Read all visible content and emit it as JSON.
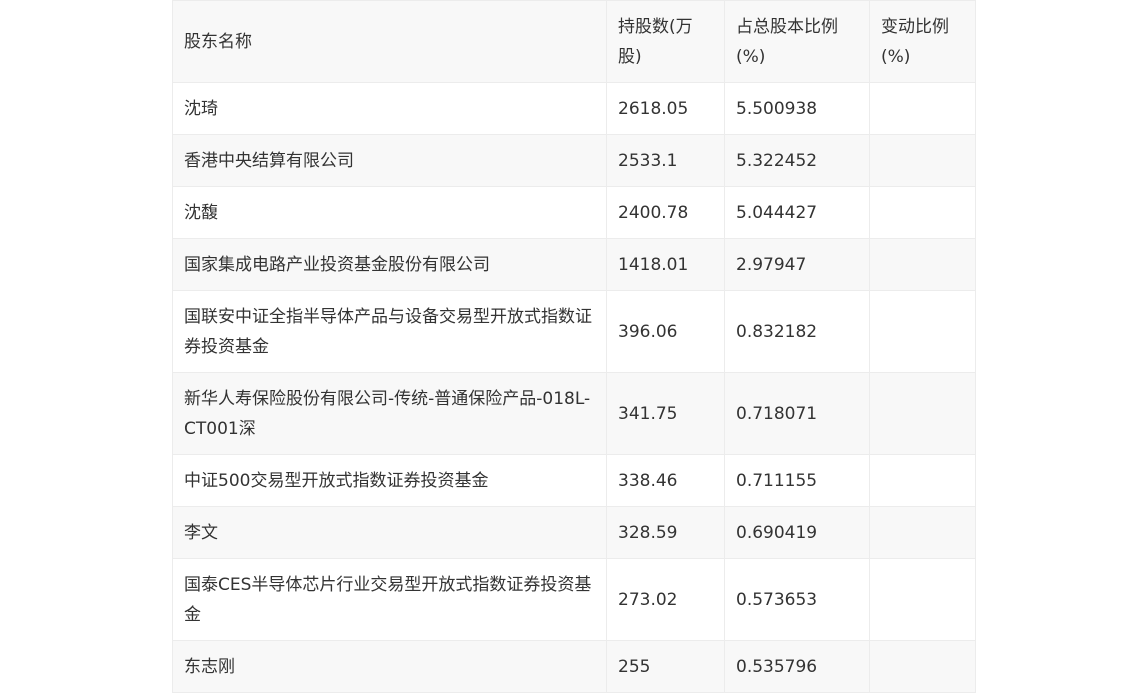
{
  "table": {
    "headers": [
      "股东名称",
      "持股数(万股)",
      "占总股本比例(%)",
      "变动比例(%)"
    ],
    "rows": [
      {
        "name": "沈琦",
        "shares": "2618.05",
        "ratio": "5.500938",
        "change": ""
      },
      {
        "name": "香港中央结算有限公司",
        "shares": "2533.1",
        "ratio": "5.322452",
        "change": ""
      },
      {
        "name": "沈馥",
        "shares": "2400.78",
        "ratio": "5.044427",
        "change": ""
      },
      {
        "name": "国家集成电路产业投资基金股份有限公司",
        "shares": "1418.01",
        "ratio": "2.97947",
        "change": ""
      },
      {
        "name": "国联安中证全指半导体产品与设备交易型开放式指数证券投资基金",
        "shares": "396.06",
        "ratio": "0.832182",
        "change": ""
      },
      {
        "name": "新华人寿保险股份有限公司-传统-普通保险产品-018L-CT001深",
        "shares": "341.75",
        "ratio": "0.718071",
        "change": ""
      },
      {
        "name": "中证500交易型开放式指数证券投资基金",
        "shares": "338.46",
        "ratio": "0.711155",
        "change": ""
      },
      {
        "name": "李文",
        "shares": "328.59",
        "ratio": "0.690419",
        "change": ""
      },
      {
        "name": "国泰CES半导体芯片行业交易型开放式指数证券投资基金",
        "shares": "273.02",
        "ratio": "0.573653",
        "change": ""
      },
      {
        "name": "东志刚",
        "shares": "255",
        "ratio": "0.535796",
        "change": ""
      }
    ]
  }
}
